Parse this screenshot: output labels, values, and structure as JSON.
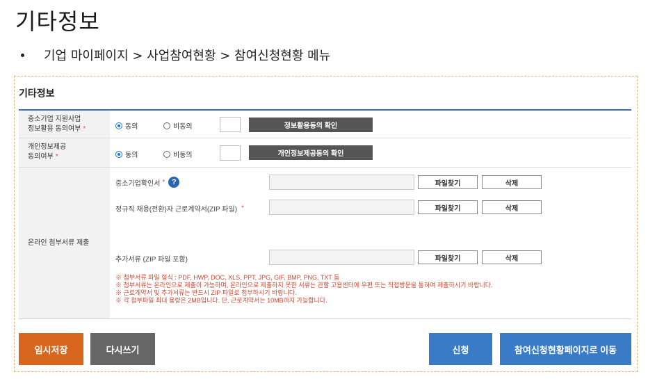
{
  "page": {
    "title": "기타정보",
    "breadcrumb": "기업 마이페이지 > 사업참여현황 > 참여신청현황 메뉴"
  },
  "section": {
    "title": "기타정보"
  },
  "consent_rows": [
    {
      "label_line1": "중소기업 지원사업",
      "label_line2": "정보활용 동의여부",
      "required": "*",
      "agree": "동의",
      "disagree": "비동의",
      "selected": "동의",
      "button": "정보활용동의 확인"
    },
    {
      "label_line1": "개인정보제공",
      "label_line2": "동의여부",
      "required": "*",
      "agree": "동의",
      "disagree": "비동의",
      "selected": "동의",
      "button": "개인정보제공동의 확인"
    }
  ],
  "attachments": {
    "label": "온라인 첨부서류 제출",
    "files": [
      {
        "name": "중소기업확인서",
        "required": "*",
        "help": "?",
        "find": "파일찾기",
        "delete": "삭제"
      },
      {
        "name": "정규직 채용(전환)자 근로계약서(ZIP 파일)",
        "required": "*",
        "find": "파일찾기",
        "delete": "삭제"
      },
      {
        "name": "추가서류 (ZIP 파일 포함)",
        "find": "파일찾기",
        "delete": "삭제"
      }
    ],
    "notices": [
      "※ 첨부서류 파일 형식 : PDF, HWP, DOC, XLS, PPT, JPG, GIF, BMP, PNG, TXT 등",
      "※ 첨부서류는 온라인으로 제출이 가능하며, 온라인으로 제출하지 못한 서류는 관할 고용센터에 우편 또는 직접방문을 통하여 제출하시기 바랍니다.",
      "※ 근로계약서 및 추가서류는 반드시 ZIP 파일로 첨부하시기 바랍니다.",
      "※ 각 첨부파일 최대 용량은 2MB입니다. 단, 근로계약서는 10MB까지 가능합니다."
    ]
  },
  "actions": {
    "temp_save": "임시저장",
    "rewrite": "다시쓰기",
    "apply": "신청",
    "go_status": "참여신청현황페이지로 이동"
  },
  "colors": {
    "temp_save": "#d9661f",
    "rewrite": "#666666",
    "apply": "#3a7bc8",
    "go_status": "#3a7bc8",
    "section_line": "#3a6fb7",
    "notice": "#d2452f"
  }
}
